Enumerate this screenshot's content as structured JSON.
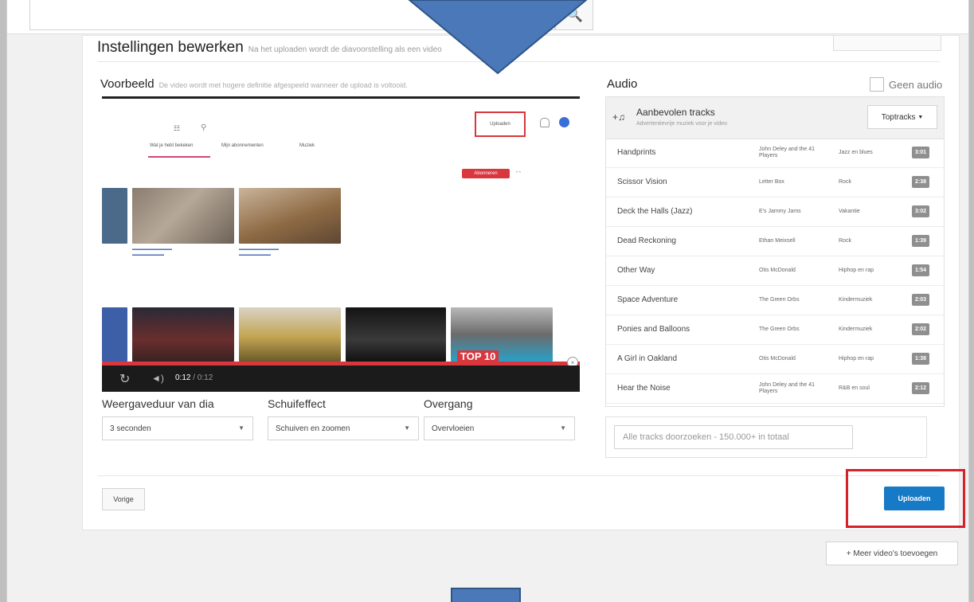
{
  "header": {
    "title": "Instellingen bewerken",
    "subtitle": "Na het uploaden wordt de diavoorstelling als een video"
  },
  "preview": {
    "title": "Voorbeeld",
    "subtitle": "De video wordt met hogere definitie afgespeeld wanneer de upload is voltooid.",
    "upload_label": "Uploaden",
    "tabs": [
      "Wat je hebt bekeken",
      "Mijn abonnementen",
      "Muziek"
    ],
    "subscribe_label": "Abonneren",
    "top10_label": "TOP 10",
    "current_time": "0:12",
    "duration": "/ 0:12"
  },
  "settings": {
    "slide_duration_label": "Weergaveduur van dia",
    "slide_duration_value": "3 seconden",
    "slide_effect_label": "Schuifeffect",
    "slide_effect_value": "Schuiven en zoomen",
    "transition_label": "Overgang",
    "transition_value": "Overvloeien"
  },
  "audio": {
    "title": "Audio",
    "no_audio_label": "Geen audio",
    "recommended_title": "Aanbevolen tracks",
    "recommended_sub": "Advertentievrije muziek voor je video",
    "dropdown_label": "Toptracks",
    "tracks": [
      {
        "name": "Handprints",
        "artist": "John Deley and the 41 Players",
        "genre": "Jazz en blues",
        "duration": "3:01"
      },
      {
        "name": "Scissor Vision",
        "artist": "Letter Box",
        "genre": "Rock",
        "duration": "2:38"
      },
      {
        "name": "Deck the Halls (Jazz)",
        "artist": "E's Jammy Jams",
        "genre": "Vakantie",
        "duration": "3:02"
      },
      {
        "name": "Dead Reckoning",
        "artist": "Ethan Meixsell",
        "genre": "Rock",
        "duration": "1:39"
      },
      {
        "name": "Other Way",
        "artist": "Otis McDonald",
        "genre": "Hiphop en rap",
        "duration": "1:54"
      },
      {
        "name": "Space Adventure",
        "artist": "The Green Orbs",
        "genre": "Kindermuziek",
        "duration": "2:03"
      },
      {
        "name": "Ponies and Balloons",
        "artist": "The Green Orbs",
        "genre": "Kindermuziek",
        "duration": "2:02"
      },
      {
        "name": "A Girl in Oakland",
        "artist": "Otis McDonald",
        "genre": "Hiphop en rap",
        "duration": "1:38"
      },
      {
        "name": "Hear the Noise",
        "artist": "John Deley and the 41 Players",
        "genre": "R&B en soul",
        "duration": "2:12"
      }
    ],
    "search_placeholder": "Alle tracks doorzoeken - 150.000+ in totaal"
  },
  "footer": {
    "back_label": "Vorige",
    "upload_label": "Uploaden",
    "more_videos_label": "+ Meer video's toevoegen"
  },
  "colors": {
    "primary": "#167ac6",
    "highlight": "#d6202a",
    "arrow": "#4a78b8"
  }
}
